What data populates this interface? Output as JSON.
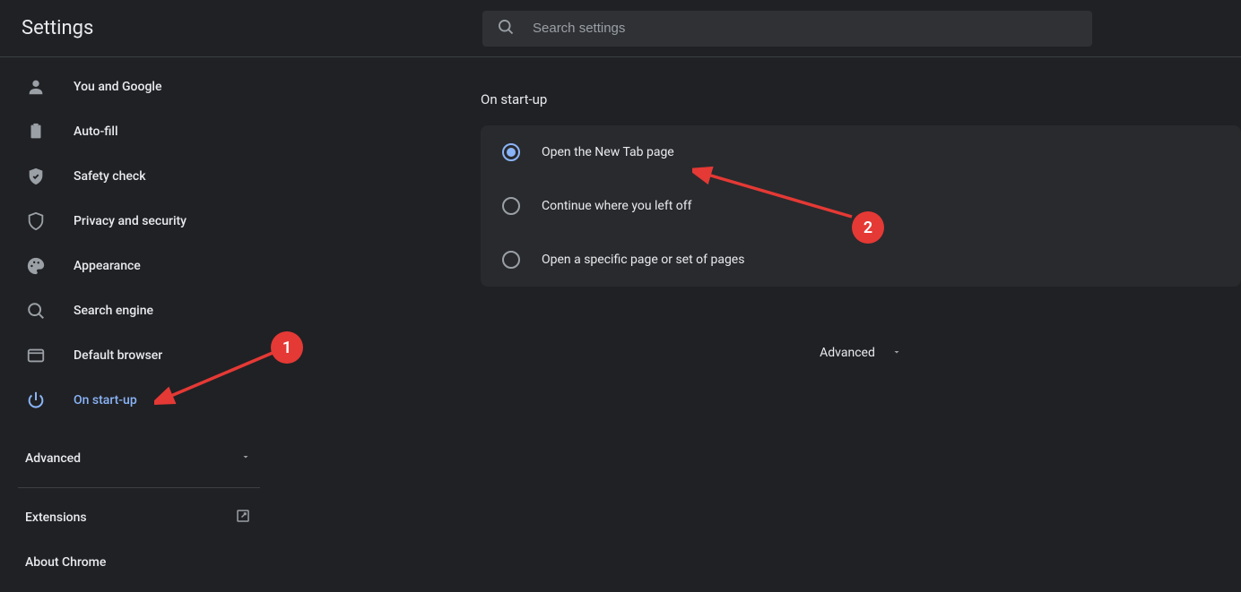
{
  "header": {
    "title": "Settings",
    "search_placeholder": "Search settings"
  },
  "sidebar": {
    "items": [
      {
        "label": "You and Google",
        "icon": "user"
      },
      {
        "label": "Auto-fill",
        "icon": "clipboard"
      },
      {
        "label": "Safety check",
        "icon": "shield-check"
      },
      {
        "label": "Privacy and security",
        "icon": "shield"
      },
      {
        "label": "Appearance",
        "icon": "palette"
      },
      {
        "label": "Search engine",
        "icon": "search"
      },
      {
        "label": "Default browser",
        "icon": "browser"
      },
      {
        "label": "On start-up",
        "icon": "power",
        "active": true
      }
    ],
    "advanced_label": "Advanced",
    "extensions_label": "Extensions",
    "about_label": "About Chrome"
  },
  "main": {
    "section_title": "On start-up",
    "options": [
      {
        "label": "Open the New Tab page",
        "checked": true
      },
      {
        "label": "Continue where you left off",
        "checked": false
      },
      {
        "label": "Open a specific page or set of pages",
        "checked": false
      }
    ],
    "advanced_label": "Advanced"
  },
  "annotations": {
    "badge1": "1",
    "badge2": "2"
  }
}
